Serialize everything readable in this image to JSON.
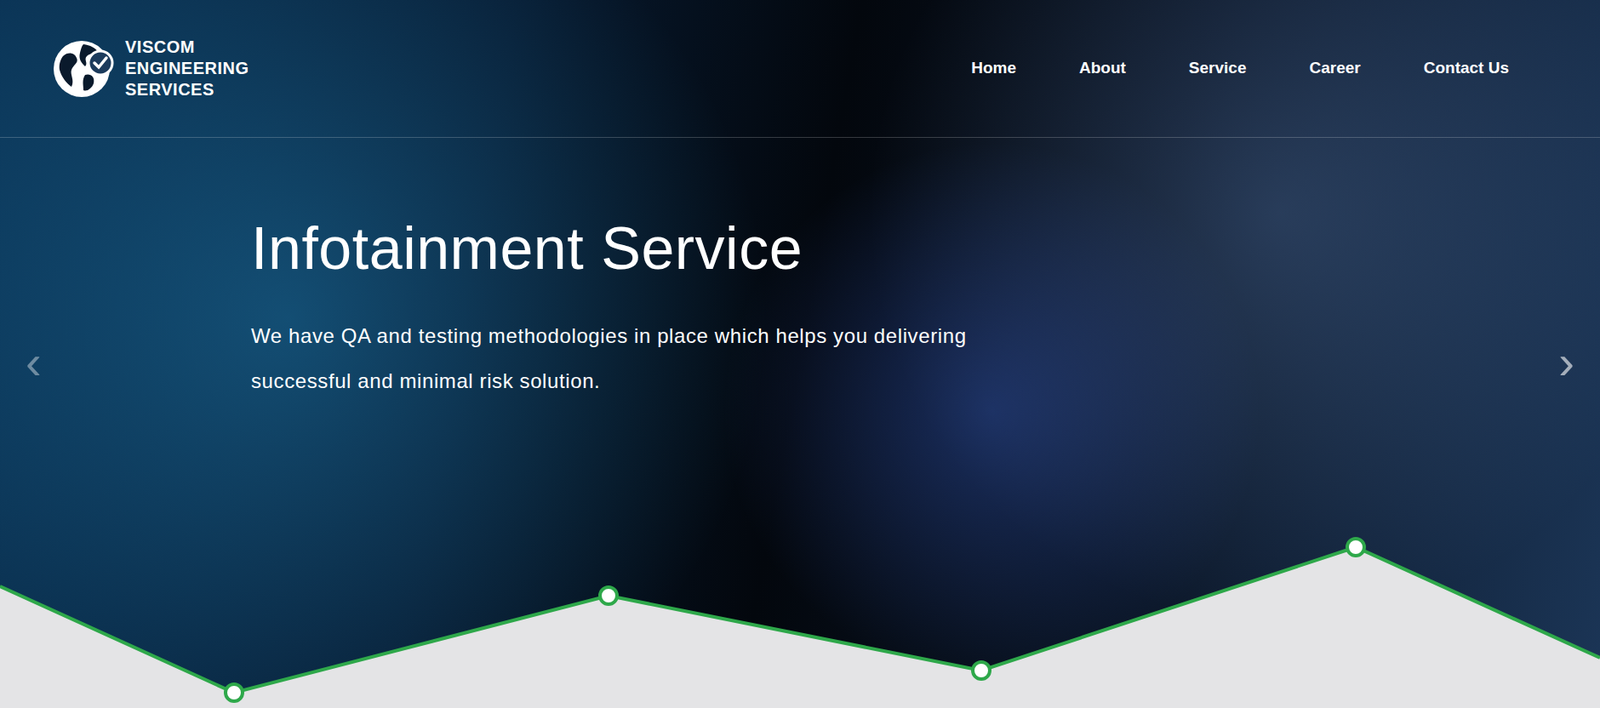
{
  "logo": {
    "lines": [
      "VISCOM",
      "ENGINEERING",
      "SERVICES"
    ]
  },
  "nav": [
    {
      "label": "Home"
    },
    {
      "label": "About"
    },
    {
      "label": "Service"
    },
    {
      "label": "Career"
    },
    {
      "label": "Contact Us"
    }
  ],
  "slide": {
    "title": "Infotainment Service",
    "text": "We have QA and testing methodologies in place which helps you delivering successful and minimal risk solution."
  },
  "arrows": {
    "prev": "‹",
    "next": "›"
  }
}
